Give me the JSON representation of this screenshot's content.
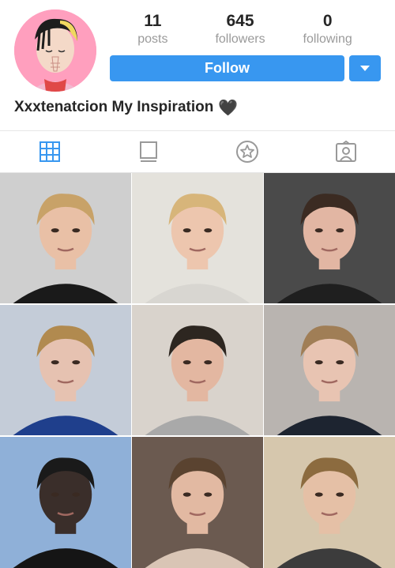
{
  "profile": {
    "bio": "Xxxtenatcion My Inspiration",
    "bio_emoji": "🖤"
  },
  "stats": [
    {
      "value": "11",
      "label": "posts"
    },
    {
      "value": "645",
      "label": "followers"
    },
    {
      "value": "0",
      "label": "following"
    }
  ],
  "actions": {
    "follow_label": "Follow",
    "dropdown_icon": "chevron-down-icon"
  },
  "tabs": [
    {
      "icon": "grid-icon",
      "active": true
    },
    {
      "icon": "list-icon",
      "active": false
    },
    {
      "icon": "star-icon",
      "active": false
    },
    {
      "icon": "tagged-icon",
      "active": false
    }
  ],
  "colors": {
    "accent": "#3897f0",
    "muted": "#9a9a9a",
    "text": "#262626"
  },
  "photos": [
    {
      "bg": "#cfcfcf",
      "skin": "#e9c0a6",
      "hair": "#c8a268",
      "shirt": "#1a1a1a"
    },
    {
      "bg": "#e4e2dc",
      "skin": "#edc6ae",
      "hair": "#d7b57a",
      "shirt": "#d8d6d1"
    },
    {
      "bg": "#4a4a4a",
      "skin": "#e2b6a3",
      "hair": "#3b2b22",
      "shirt": "#1f1f1f"
    },
    {
      "bg": "#c4ccd8",
      "skin": "#e6c2b1",
      "hair": "#b18a4f",
      "shirt": "#1f3f8c"
    },
    {
      "bg": "#d9d3cc",
      "skin": "#e3b7a1",
      "hair": "#2d2620",
      "shirt": "#a9a9a9"
    },
    {
      "bg": "#b9b4b0",
      "skin": "#e8c4b2",
      "hair": "#a07e56",
      "shirt": "#1d2430"
    },
    {
      "bg": "#8fb0d8",
      "skin": "#3a2e2a",
      "hair": "#1a1a1a",
      "shirt": "#151515"
    },
    {
      "bg": "#6b5a50",
      "skin": "#e2b9a2",
      "hair": "#5a4330",
      "shirt": "#d9c5b5"
    },
    {
      "bg": "#d6c7ad",
      "skin": "#e5c0a6",
      "hair": "#8c6b3f",
      "shirt": "#3c3c3c"
    }
  ]
}
